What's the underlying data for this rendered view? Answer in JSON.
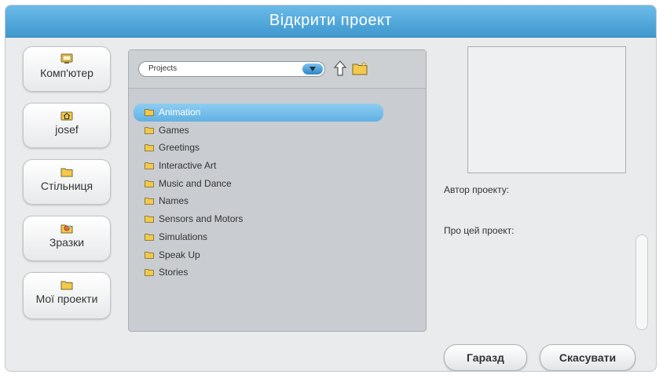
{
  "dialog": {
    "title": "Відкрити проект"
  },
  "places": [
    {
      "label": "Комп'ютер",
      "icon": "computer-icon"
    },
    {
      "label": "josef",
      "icon": "home-icon"
    },
    {
      "label": "Стільниця",
      "icon": "folder-icon"
    },
    {
      "label": "Зразки",
      "icon": "examples-icon"
    },
    {
      "label": "Мої проекти",
      "icon": "folder-icon"
    }
  ],
  "browser": {
    "path": "Projects",
    "items": [
      {
        "label": "Animation",
        "selected": true
      },
      {
        "label": "Games"
      },
      {
        "label": "Greetings"
      },
      {
        "label": "Interactive Art"
      },
      {
        "label": "Music and Dance"
      },
      {
        "label": "Names"
      },
      {
        "label": "Sensors and Motors"
      },
      {
        "label": "Simulations"
      },
      {
        "label": "Speak Up"
      },
      {
        "label": "Stories"
      }
    ]
  },
  "info": {
    "author_label": "Автор проекту:",
    "about_label": "Про цей проект:"
  },
  "buttons": {
    "ok": "Гаразд",
    "cancel": "Скасувати"
  },
  "colors": {
    "titlebar": "#4aa3d8",
    "selection": "#6fbce9",
    "folder": "#f2c94c"
  }
}
